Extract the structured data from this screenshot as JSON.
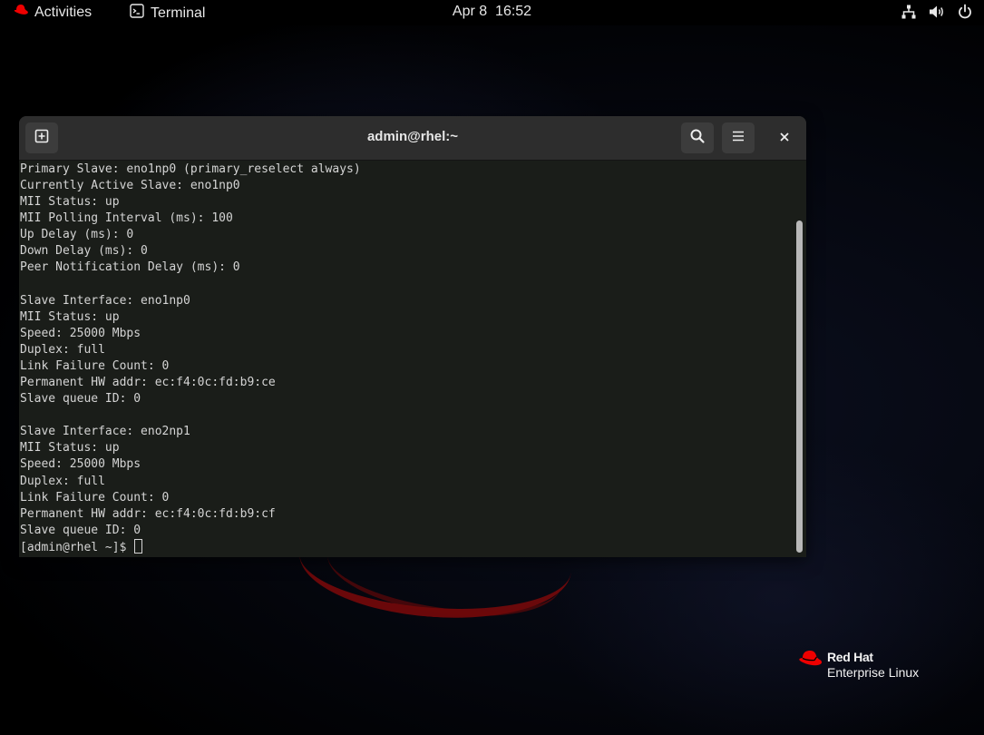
{
  "topbar": {
    "activities_label": "Activities",
    "app_label": "Terminal",
    "clock": "Apr 8  16:52",
    "icons": [
      "network-icon",
      "volume-icon",
      "power-icon"
    ]
  },
  "window": {
    "title": "admin@rhel:~",
    "buttons": [
      "new-tab-icon",
      "search-icon",
      "hamburger-menu-icon",
      "close-icon"
    ]
  },
  "terminal": {
    "lines": [
      "Primary Slave: eno1np0 (primary_reselect always)",
      "Currently Active Slave: eno1np0",
      "MII Status: up",
      "MII Polling Interval (ms): 100",
      "Up Delay (ms): 0",
      "Down Delay (ms): 0",
      "Peer Notification Delay (ms): 0",
      "",
      "Slave Interface: eno1np0",
      "MII Status: up",
      "Speed: 25000 Mbps",
      "Duplex: full",
      "Link Failure Count: 0",
      "Permanent HW addr: ec:f4:0c:fd:b9:ce",
      "Slave queue ID: 0",
      "",
      "Slave Interface: eno2np1",
      "MII Status: up",
      "Speed: 25000 Mbps",
      "Duplex: full",
      "Link Failure Count: 0",
      "Permanent HW addr: ec:f4:0c:fd:b9:cf",
      "Slave queue ID: 0"
    ],
    "prompt": "[admin@rhel ~]$ "
  },
  "branding": {
    "line1": "Red Hat",
    "line2": "Enterprise Linux",
    "accent_color": "#ee0000"
  }
}
